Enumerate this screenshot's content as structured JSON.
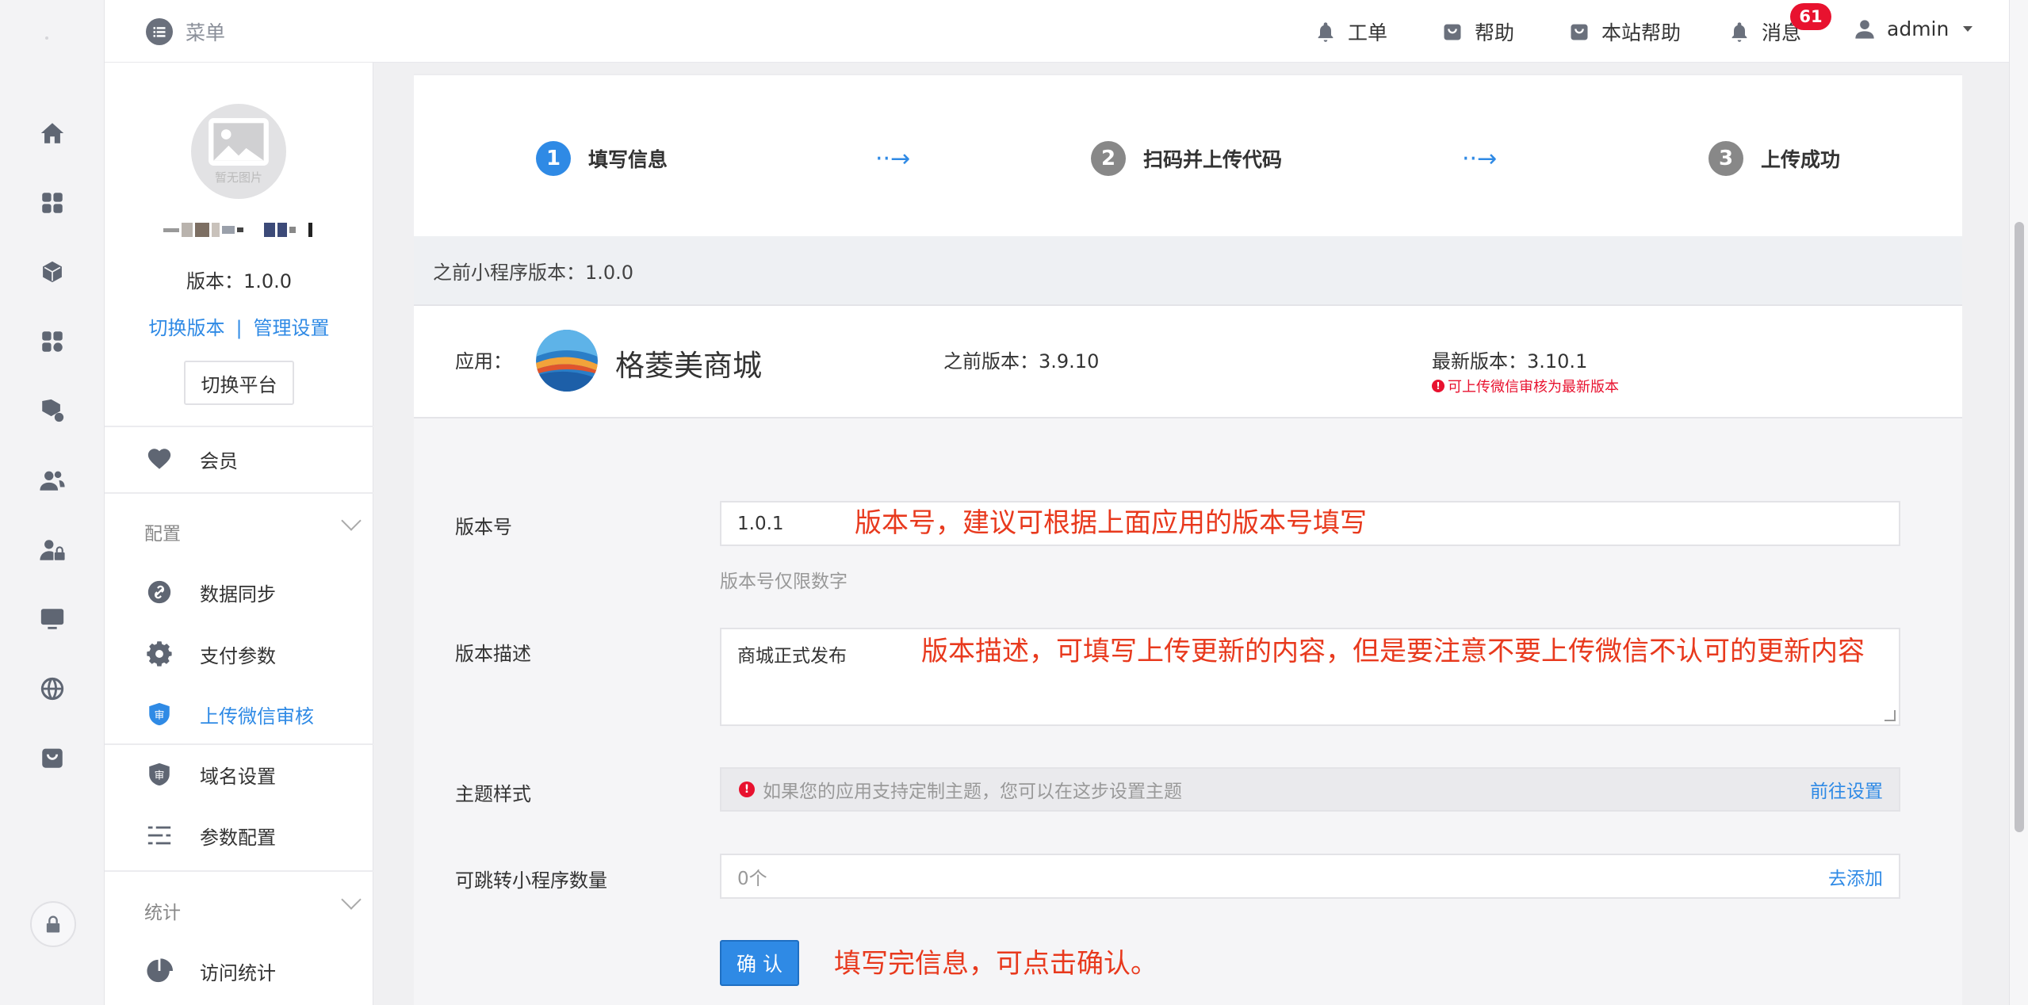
{
  "colors": {
    "accent": "#2f8ae5",
    "badge": "#e8122f",
    "annotation": "#e8391d"
  },
  "rail": {
    "icons": [
      "home-icon",
      "apps-icon",
      "box-icon",
      "apps-settings-icon",
      "box-settings-icon",
      "users-icon",
      "user-lock-icon",
      "monitor-icon",
      "globe-icon",
      "shop-icon"
    ],
    "lock_icon": "lock-icon"
  },
  "header": {
    "menu_label": "菜单",
    "nav": [
      {
        "label": "工单",
        "icon": "bell-icon"
      },
      {
        "label": "帮助",
        "icon": "bag-icon"
      },
      {
        "label": "本站帮助",
        "icon": "bag-icon"
      },
      {
        "label": "消息",
        "icon": "bell-icon"
      }
    ],
    "badge_count": "61",
    "user": "admin"
  },
  "sidebar": {
    "avatar_text": "暂无图片",
    "version": "版本：1.0.0",
    "switch_version": "切换版本",
    "link_sep": "|",
    "manage_settings": "管理设置",
    "switch_platform": "切换平台",
    "member": "会员",
    "group_config": "配置",
    "items": [
      {
        "label": "数据同步",
        "icon": "link-icon"
      },
      {
        "label": "支付参数",
        "icon": "gear-icon"
      },
      {
        "label": "上传微信审核",
        "icon": "shield-icon",
        "active": true
      },
      {
        "label": "域名设置",
        "icon": "shield-icon"
      },
      {
        "label": "参数配置",
        "icon": "list-icon"
      }
    ],
    "group_stats": "统计",
    "stats_item": "访问统计"
  },
  "steps": [
    {
      "num": "1",
      "label": "填写信息",
      "current": true
    },
    {
      "num": "2",
      "label": "扫码并上传代码",
      "current": false
    },
    {
      "num": "3",
      "label": "上传成功",
      "current": false
    }
  ],
  "step_arrow": "··→",
  "previous_version_bar": "之前小程序版本：1.0.0",
  "app": {
    "label": "应用：",
    "name": "格菱美商城",
    "previous": "之前版本：3.9.10",
    "latest": "最新版本：3.10.1",
    "latest_note": "可上传微信审核为最新版本",
    "note_icon": "!"
  },
  "form": {
    "version_label": "版本号",
    "version_value": "1.0.1",
    "version_help": "版本号仅限数字",
    "desc_label": "版本描述",
    "desc_value": "商城正式发布",
    "theme_label": "主题样式",
    "theme_hint": "如果您的应用支持定制主题，您可以在这步设置主题",
    "theme_link": "前往设置",
    "jump_label": "可跳转小程序数量",
    "jump_value": "0个",
    "jump_link": "去添加",
    "confirm": "确 认"
  },
  "annotations": {
    "version": "版本号，建议可根据上面应用的版本号填写",
    "desc": "版本描述，可填写上传更新的内容，但是要注意不要上传微信不认可的更新内容",
    "confirm": "填写完信息，可点击确认。"
  }
}
